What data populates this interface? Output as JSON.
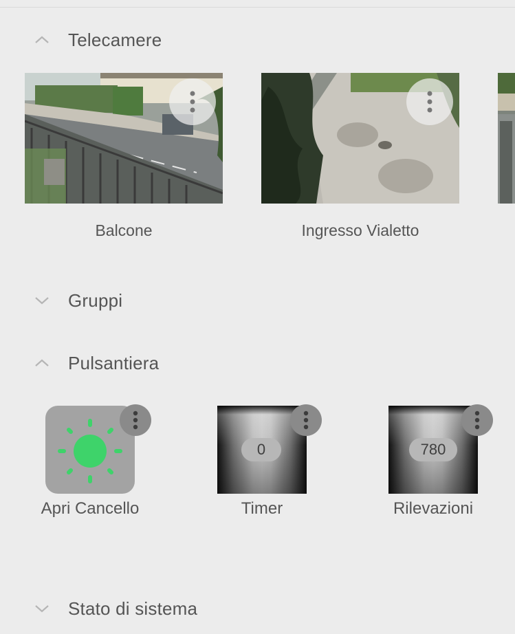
{
  "sections": {
    "cameras": {
      "title": "Telecamere",
      "expanded": true,
      "chevron": "chevron-up-icon"
    },
    "groups": {
      "title": "Gruppi",
      "expanded": false,
      "chevron": "chevron-down-icon"
    },
    "buttons": {
      "title": "Pulsantiera",
      "expanded": true,
      "chevron": "chevron-up-icon"
    },
    "system": {
      "title": "Stato di sistema",
      "expanded": false,
      "chevron": "chevron-down-icon"
    }
  },
  "cameras": [
    {
      "label": "Balcone",
      "menu_icon": "more-vertical-icon"
    },
    {
      "label": "Ingresso Vialetto",
      "menu_icon": "more-vertical-icon"
    }
  ],
  "tiles": [
    {
      "label": "Apri Cancello",
      "icon": "sun-icon",
      "icon_color": "#3ed36a",
      "menu_icon": "more-vertical-icon"
    },
    {
      "label": "Timer",
      "value": "0",
      "menu_icon": "more-vertical-icon"
    },
    {
      "label": "Rilevazioni",
      "value": "780",
      "menu_icon": "more-vertical-icon"
    }
  ],
  "colors": {
    "background": "#ececec",
    "accent_green": "#3ed36a",
    "text": "#555555"
  }
}
